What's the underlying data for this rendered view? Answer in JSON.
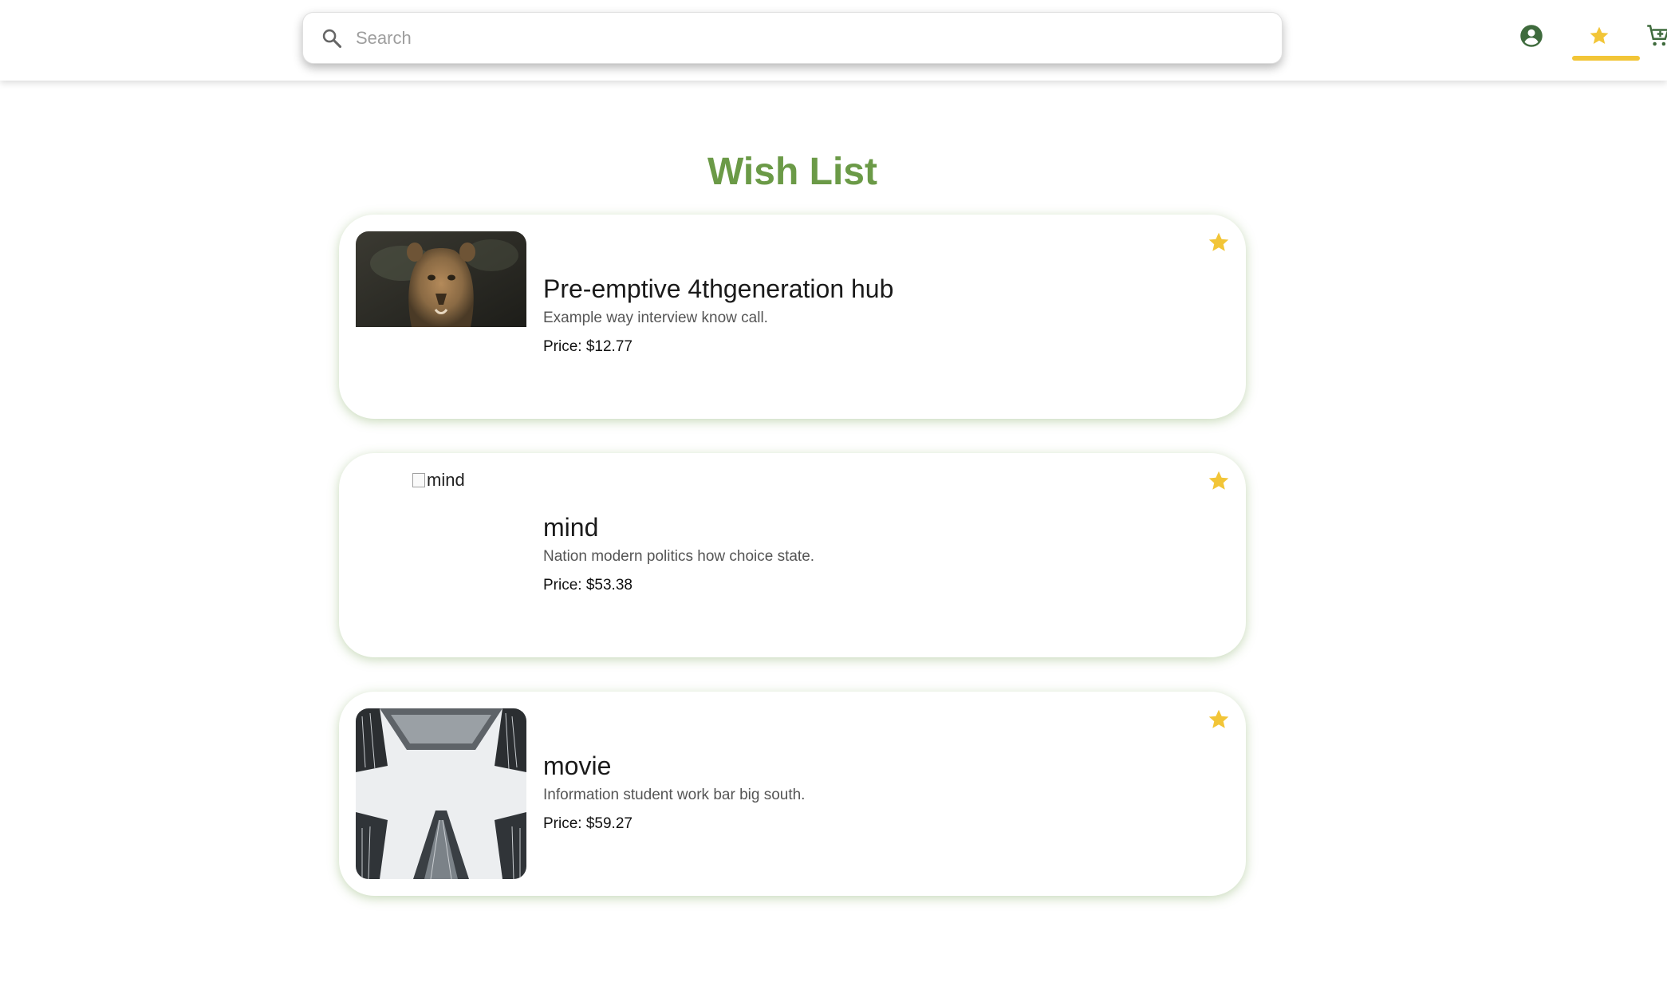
{
  "search": {
    "placeholder": "Search",
    "value": ""
  },
  "nav": {
    "account_icon": "account-circle-icon",
    "wishlist_icon": "star-icon",
    "cart_icon": "cart-icon",
    "active": "wishlist"
  },
  "page": {
    "title": "Wish List"
  },
  "colors": {
    "accent_green": "#6b9a47",
    "star_yellow": "#f2c537",
    "icon_green": "#3f6b3d"
  },
  "wishlist": {
    "items": [
      {
        "title": "Pre-emptive 4thgeneration hub",
        "description": "Example way interview know call.",
        "price": "Price: $12.77",
        "image_alt": "Pre-emptive 4thgeneration hub",
        "image_loaded": true
      },
      {
        "title": "mind",
        "description": "Nation modern politics how choice state.",
        "price": "Price: $53.38",
        "image_alt": "mind",
        "image_loaded": false
      },
      {
        "title": "movie",
        "description": "Information student work bar big south.",
        "price": "Price: $59.27",
        "image_alt": "movie",
        "image_loaded": true
      }
    ]
  }
}
